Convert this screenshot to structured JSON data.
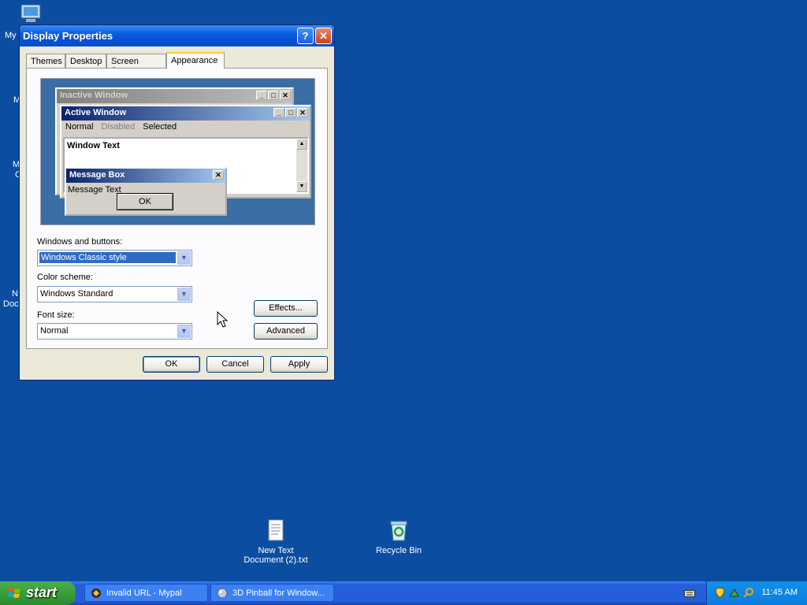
{
  "desktop": {
    "icons": [
      {
        "label_line1": "New Text",
        "label_line2": "Document (2).txt",
        "icon": "text-file-icon"
      },
      {
        "label_line1": "Recycle Bin",
        "label_line2": "",
        "icon": "recycle-bin-icon"
      }
    ],
    "clipped_labels": [
      "My",
      "M",
      "M",
      "C",
      "N",
      "Doc"
    ]
  },
  "dialog": {
    "title": "Display Properties",
    "help_button": "?",
    "close_button": "✕",
    "tabs": [
      {
        "label": "Themes",
        "active": false
      },
      {
        "label": "Desktop",
        "active": false
      },
      {
        "label": "Screen Saver",
        "active": false
      },
      {
        "label": "Appearance",
        "active": true
      }
    ],
    "preview": {
      "inactive_title": "Inactive Window",
      "active_title": "Active Window",
      "menu_normal": "Normal",
      "menu_disabled": "Disabled",
      "menu_selected": "Selected",
      "window_text": "Window Text",
      "message_title": "Message Box",
      "message_text": "Message Text",
      "message_ok": "OK"
    },
    "windows_buttons_label": "Windows and buttons:",
    "windows_buttons_value": "Windows Classic style",
    "color_scheme_label": "Color scheme:",
    "color_scheme_value": "Windows Standard",
    "font_size_label": "Font size:",
    "font_size_value": "Normal",
    "effects_button": "Effects...",
    "advanced_button": "Advanced",
    "ok_button": "OK",
    "cancel_button": "Cancel",
    "apply_button": "Apply"
  },
  "taskbar": {
    "start_label": "start",
    "tasks": [
      {
        "label": "Invalid URL - Mypal",
        "icon": "mypal-browser-icon"
      },
      {
        "label": "3D Pinball for Window...",
        "icon": "pinball-icon"
      }
    ],
    "clock": "11:45 AM"
  },
  "colors": {
    "desktop_bg": "#0b4ea1",
    "titlebar_blue": "#0a5fe0",
    "start_green": "#389e38",
    "classic_active_caption": "#0a246a",
    "preview_bg": "#3a6ea5"
  }
}
